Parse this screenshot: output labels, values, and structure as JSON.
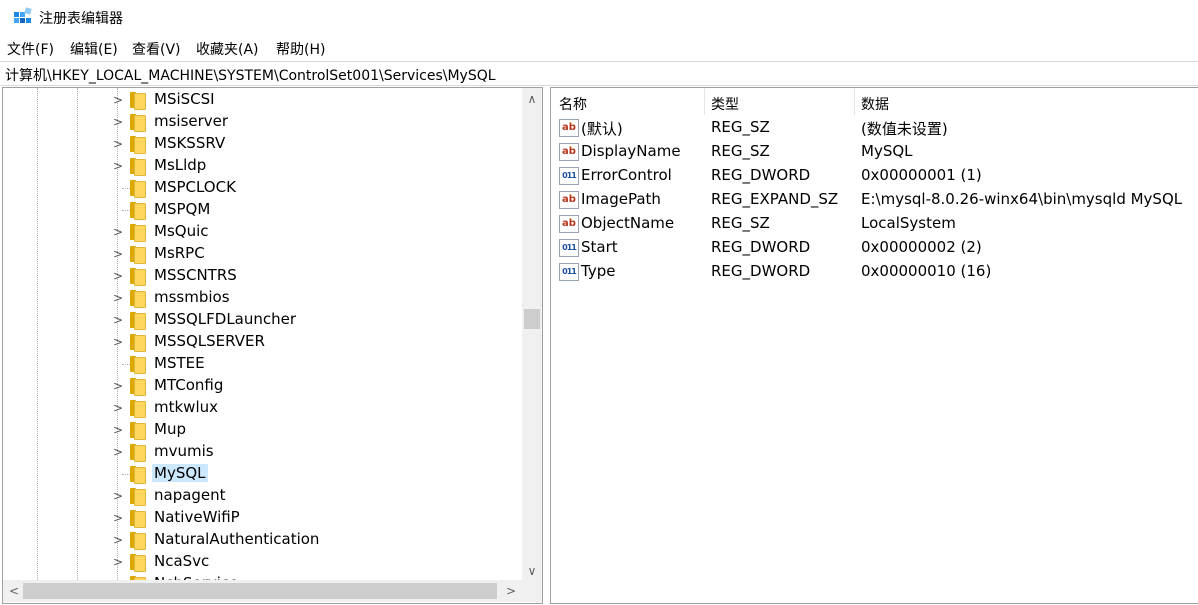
{
  "window": {
    "title": "注册表编辑器",
    "app_icon": "registry-editor-icon"
  },
  "menu": [
    "文件(F)",
    "编辑(E)",
    "查看(V)",
    "收藏夹(A)",
    "帮助(H)"
  ],
  "address": "计算机\\HKEY_LOCAL_MACHINE\\SYSTEM\\ControlSet001\\Services\\MySQL",
  "tree": {
    "nodes": [
      {
        "label": "MSiSCSI",
        "expandable": true
      },
      {
        "label": "msiserver",
        "expandable": true
      },
      {
        "label": "MSKSSRV",
        "expandable": true
      },
      {
        "label": "MsLldp",
        "expandable": true
      },
      {
        "label": "MSPCLOCK",
        "expandable": false
      },
      {
        "label": "MSPQM",
        "expandable": false
      },
      {
        "label": "MsQuic",
        "expandable": true
      },
      {
        "label": "MsRPC",
        "expandable": true
      },
      {
        "label": "MSSCNTRS",
        "expandable": true
      },
      {
        "label": "mssmbios",
        "expandable": true
      },
      {
        "label": "MSSQLFDLauncher",
        "expandable": true
      },
      {
        "label": "MSSQLSERVER",
        "expandable": true
      },
      {
        "label": "MSTEE",
        "expandable": false
      },
      {
        "label": "MTConfig",
        "expandable": true
      },
      {
        "label": "mtkwlux",
        "expandable": true
      },
      {
        "label": "Mup",
        "expandable": true
      },
      {
        "label": "mvumis",
        "expandable": true
      },
      {
        "label": "MySQL",
        "expandable": false,
        "selected": true
      },
      {
        "label": "napagent",
        "expandable": true
      },
      {
        "label": "NativeWifiP",
        "expandable": true
      },
      {
        "label": "NaturalAuthentication",
        "expandable": true
      },
      {
        "label": "NcaSvc",
        "expandable": true
      },
      {
        "label": "NcbService",
        "expandable": true
      }
    ]
  },
  "values": {
    "columns": [
      "名称",
      "类型",
      "数据"
    ],
    "rows": [
      {
        "name": "(默认)",
        "type": "REG_SZ",
        "data": "(数值未设置)",
        "icon": "ab"
      },
      {
        "name": "DisplayName",
        "type": "REG_SZ",
        "data": "MySQL",
        "icon": "ab"
      },
      {
        "name": "ErrorControl",
        "type": "REG_DWORD",
        "data": "0x00000001 (1)",
        "icon": "bin"
      },
      {
        "name": "ImagePath",
        "type": "REG_EXPAND_SZ",
        "data": "E:\\mysql-8.0.26-winx64\\bin\\mysqld MySQL",
        "icon": "ab"
      },
      {
        "name": "ObjectName",
        "type": "REG_SZ",
        "data": "LocalSystem",
        "icon": "ab"
      },
      {
        "name": "Start",
        "type": "REG_DWORD",
        "data": "0x00000002 (2)",
        "icon": "bin"
      },
      {
        "name": "Type",
        "type": "REG_DWORD",
        "data": "0x00000010 (16)",
        "icon": "bin"
      }
    ]
  }
}
